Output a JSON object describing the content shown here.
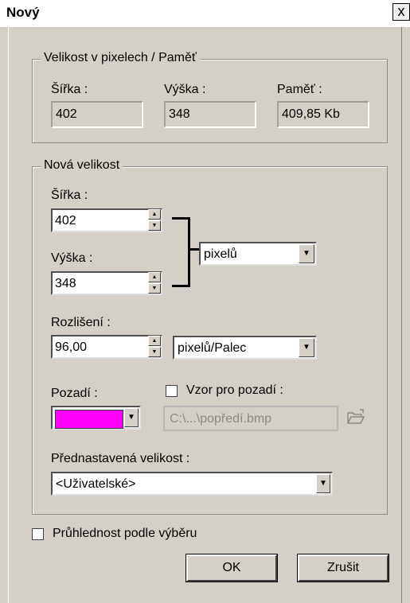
{
  "window": {
    "title": "Nový",
    "close_label": "x"
  },
  "pixel_size_group": {
    "legend": "Velikost v pixelech / Paměť",
    "width_label": "Šířka :",
    "width_value": "402",
    "height_label": "Výška :",
    "height_value": "348",
    "memory_label": "Paměť :",
    "memory_value": "409,85 Kb"
  },
  "new_size_group": {
    "legend": "Nová velikost",
    "width_label": "Šířka :",
    "width_value": "402",
    "height_label": "Výška :",
    "height_value": "348",
    "unit_selected": "pixelů",
    "resolution_label": "Rozlišení :",
    "resolution_value": "96,00",
    "resolution_unit_selected": "pixelů/Palec",
    "background_label": "Pozadí :",
    "background_color": "#ff00ff",
    "pattern_label": "Vzor pro pozadí :",
    "pattern_path": "C:\\...\\popředí.bmp",
    "preset_label": "Přednastavená velikost :",
    "preset_selected": "<Uživatelské>"
  },
  "transparency_label": "Průhlednost podle výběru",
  "buttons": {
    "ok": "OK",
    "cancel": "Zrušit"
  },
  "icons": {
    "close": "close-icon",
    "dropdown": "chevron-down-icon",
    "spin_up": "spin-up-icon",
    "spin_down": "spin-down-icon",
    "folder": "folder-open-icon"
  }
}
